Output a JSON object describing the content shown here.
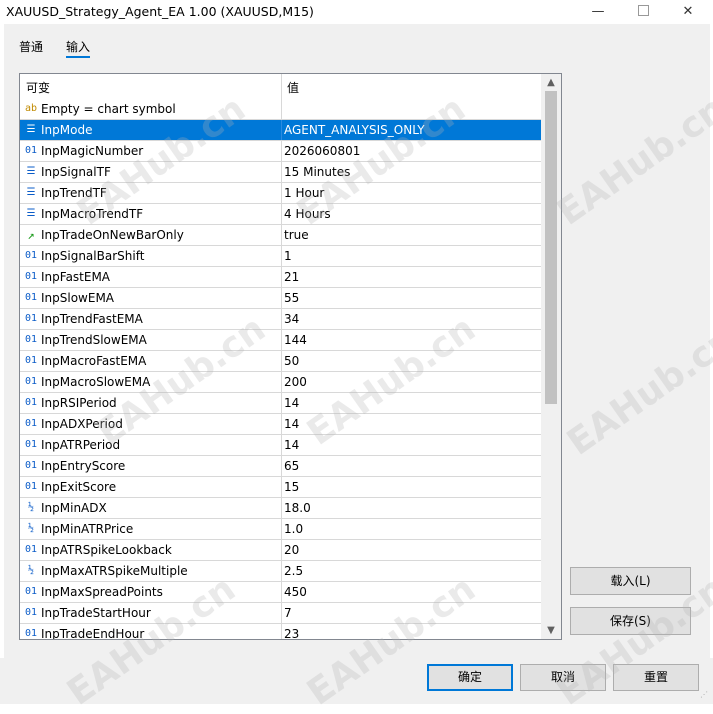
{
  "window": {
    "title": "XAUUSD_Strategy_Agent_EA 1.00 (XAUUSD,M15)",
    "min_glyph": "—",
    "close_glyph": "✕"
  },
  "tabs": [
    {
      "label": "普通",
      "active": false
    },
    {
      "label": "输入",
      "active": true
    }
  ],
  "grid": {
    "columns": [
      "可变",
      "值"
    ],
    "rows": [
      {
        "icon": "ab-icon",
        "glyph": "ab",
        "name": "Empty = chart symbol",
        "value": ""
      },
      {
        "icon": "enum-icon",
        "glyph": "☰",
        "name": "InpMode",
        "value": "AGENT_ANALYSIS_ONLY",
        "selected": true
      },
      {
        "icon": "int-icon",
        "glyph": "01",
        "name": "InpMagicNumber",
        "value": "2026060801"
      },
      {
        "icon": "enum-icon",
        "glyph": "☰",
        "name": "InpSignalTF",
        "value": "15 Minutes"
      },
      {
        "icon": "enum-icon",
        "glyph": "☰",
        "name": "InpTrendTF",
        "value": "1 Hour"
      },
      {
        "icon": "enum-icon",
        "glyph": "☰",
        "name": "InpMacroTrendTF",
        "value": "4 Hours"
      },
      {
        "icon": "bool-icon",
        "glyph": "↗",
        "name": "InpTradeOnNewBarOnly",
        "value": "true"
      },
      {
        "icon": "int-icon",
        "glyph": "01",
        "name": "InpSignalBarShift",
        "value": "1"
      },
      {
        "icon": "int-icon",
        "glyph": "01",
        "name": "InpFastEMA",
        "value": "21"
      },
      {
        "icon": "int-icon",
        "glyph": "01",
        "name": "InpSlowEMA",
        "value": "55"
      },
      {
        "icon": "int-icon",
        "glyph": "01",
        "name": "InpTrendFastEMA",
        "value": "34"
      },
      {
        "icon": "int-icon",
        "glyph": "01",
        "name": "InpTrendSlowEMA",
        "value": "144"
      },
      {
        "icon": "int-icon",
        "glyph": "01",
        "name": "InpMacroFastEMA",
        "value": "50"
      },
      {
        "icon": "int-icon",
        "glyph": "01",
        "name": "InpMacroSlowEMA",
        "value": "200"
      },
      {
        "icon": "int-icon",
        "glyph": "01",
        "name": "InpRSIPeriod",
        "value": "14"
      },
      {
        "icon": "int-icon",
        "glyph": "01",
        "name": "InpADXPeriod",
        "value": "14"
      },
      {
        "icon": "int-icon",
        "glyph": "01",
        "name": "InpATRPeriod",
        "value": "14"
      },
      {
        "icon": "int-icon",
        "glyph": "01",
        "name": "InpEntryScore",
        "value": "65"
      },
      {
        "icon": "int-icon",
        "glyph": "01",
        "name": "InpExitScore",
        "value": "15"
      },
      {
        "icon": "double-icon",
        "glyph": "½",
        "name": "InpMinADX",
        "value": "18.0"
      },
      {
        "icon": "double-icon",
        "glyph": "½",
        "name": "InpMinATRPrice",
        "value": "1.0"
      },
      {
        "icon": "int-icon",
        "glyph": "01",
        "name": "InpATRSpikeLookback",
        "value": "20"
      },
      {
        "icon": "double-icon",
        "glyph": "½",
        "name": "InpMaxATRSpikeMultiple",
        "value": "2.5"
      },
      {
        "icon": "int-icon",
        "glyph": "01",
        "name": "InpMaxSpreadPoints",
        "value": "450"
      },
      {
        "icon": "int-icon",
        "glyph": "01",
        "name": "InpTradeStartHour",
        "value": "7"
      },
      {
        "icon": "int-icon",
        "glyph": "01",
        "name": "InpTradeEndHour",
        "value": "23"
      }
    ]
  },
  "side_buttons": {
    "load": "载入(L)",
    "save": "保存(S)"
  },
  "footer_buttons": {
    "ok": "确定",
    "cancel": "取消",
    "reset": "重置"
  },
  "watermark": "EAHub.cn",
  "colors": {
    "selection": "#0078d7",
    "int_icon": "#0b5cc8",
    "string_icon": "#c08a00",
    "bool_icon": "#1a9a1a"
  }
}
